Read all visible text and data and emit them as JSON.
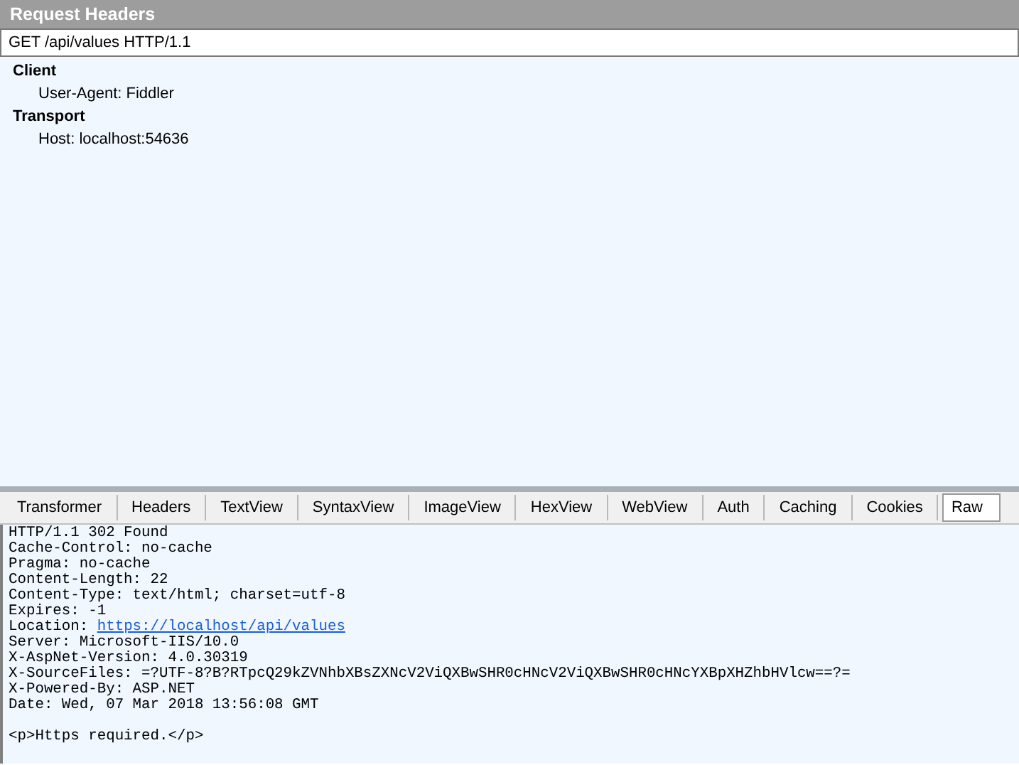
{
  "request_headers": {
    "title": "Request Headers",
    "request_line": "GET /api/values HTTP/1.1",
    "groups": [
      {
        "name": "Client",
        "headers": [
          "User-Agent: Fiddler"
        ]
      },
      {
        "name": "Transport",
        "headers": [
          "Host: localhost:54636"
        ]
      }
    ]
  },
  "tabs": [
    {
      "label": "Transformer",
      "selected": false
    },
    {
      "label": "Headers",
      "selected": false
    },
    {
      "label": "TextView",
      "selected": false
    },
    {
      "label": "SyntaxView",
      "selected": false
    },
    {
      "label": "ImageView",
      "selected": false
    },
    {
      "label": "HexView",
      "selected": false
    },
    {
      "label": "WebView",
      "selected": false
    },
    {
      "label": "Auth",
      "selected": false
    },
    {
      "label": "Caching",
      "selected": false
    },
    {
      "label": "Cookies",
      "selected": false
    },
    {
      "label": "Raw",
      "selected": true
    }
  ],
  "raw_response": {
    "lines": [
      {
        "text": "HTTP/1.1 302 Found"
      },
      {
        "text": "Cache-Control: no-cache"
      },
      {
        "text": "Pragma: no-cache"
      },
      {
        "text": "Content-Length: 22"
      },
      {
        "text": "Content-Type: text/html; charset=utf-8"
      },
      {
        "text": "Expires: -1"
      },
      {
        "text": "Location: ",
        "link": "https://localhost/api/values"
      },
      {
        "text": "Server: Microsoft-IIS/10.0"
      },
      {
        "text": "X-AspNet-Version: 4.0.30319"
      },
      {
        "text": "X-SourceFiles: =?UTF-8?B?RTpcQ29kZVNhbXBsZXNcV2ViQXBwSHR0cHNcV2ViQXBwSHR0cHNcYXBpXHZhbHVlcw==?="
      },
      {
        "text": "X-Powered-By: ASP.NET"
      },
      {
        "text": "Date: Wed, 07 Mar 2018 13:56:08 GMT"
      }
    ],
    "body": "<p>Https required.</p>"
  }
}
